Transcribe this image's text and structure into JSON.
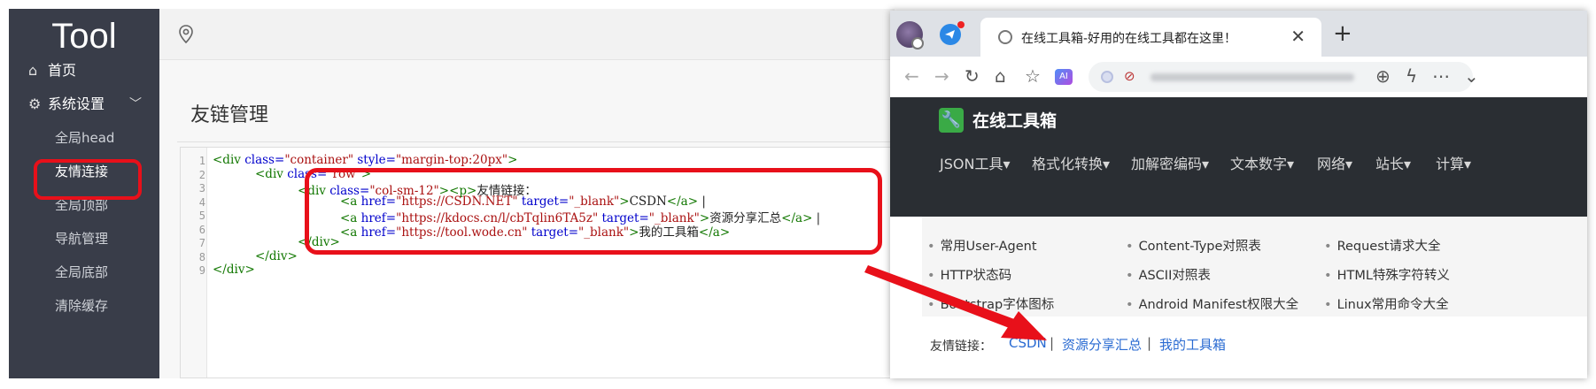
{
  "admin": {
    "logo": "Tool",
    "nav": {
      "home": "首页",
      "settings": "系统设置"
    },
    "sub_items": [
      "全局head",
      "友情连接",
      "全局顶部",
      "导航管理",
      "全局底部",
      "清除缓存"
    ],
    "page_title": "友链管理",
    "line_numbers": [
      "1",
      "2",
      "3",
      "4",
      "5",
      "6",
      "7",
      "8",
      "9"
    ],
    "code": {
      "l1_a": "<div ",
      "l1_b": "class=",
      "l1_c": "\"container\"",
      "l1_d": " style=",
      "l1_e": "\"margin-top:20px\"",
      "l1_f": ">",
      "l2_a": "<div ",
      "l2_b": "class=",
      "l2_c": "\"row\"",
      "l2_d": ">",
      "l3_a": "<div ",
      "l3_b": "class=",
      "l3_c": "\"col-sm-12\"",
      "l3_d": "><p>",
      "l3_e": "友情链接：",
      "l4_a": "<a ",
      "l4_b": "href=",
      "l4_c": "\"https://CSDN.NET\"",
      "l4_d": " target=",
      "l4_e": "\"_blank\"",
      "l4_f": ">",
      "l4_g": "CSDN",
      "l4_h": "</a>",
      "l4_i": " |",
      "l5_a": "<a ",
      "l5_b": "href=",
      "l5_c": "\"https://kdocs.cn/l/cbTqlin6TA5z\"",
      "l5_d": " target=",
      "l5_e": "\"_blank\"",
      "l5_f": ">",
      "l5_g": "资源分享汇总",
      "l5_h": "</a>",
      "l5_i": " |",
      "l6_a": "<a ",
      "l6_b": "href=",
      "l6_c": "\"https://tool.wode.cn\"",
      "l6_d": " target=",
      "l6_e": "\"_blank\"",
      "l6_f": ">",
      "l6_g": "我的工具箱",
      "l6_h": "</a>",
      "l7": "</div>",
      "l8": "</div>",
      "l9": "</div>"
    }
  },
  "browser": {
    "tab_title": "在线工具箱-好用的在线工具都在这里！",
    "site": {
      "brand": "在线工具箱",
      "menu": [
        "JSON工具▾",
        "格式化转换▾",
        "加解密编码▾",
        "文本数字▾",
        "网络▾",
        "站长▾",
        "计算▾"
      ],
      "tools": [
        [
          "常用User-Agent",
          "Content-Type对照表",
          "Request请求大全"
        ],
        [
          "HTTP状态码",
          "ASCII对照表",
          "HTML特殊字符转义"
        ],
        [
          "Bootstrap字体图标",
          "Android Manifest权限大全",
          "Linux常用命令大全"
        ]
      ],
      "friend_label": "友情链接：",
      "friend_links": [
        "CSDN",
        "资源分享汇总",
        "我的工具箱"
      ],
      "separator": "|"
    }
  },
  "colors": {
    "highlight": "#e8101a",
    "sidebar": "#393d49",
    "link": "#2a6bd2"
  }
}
